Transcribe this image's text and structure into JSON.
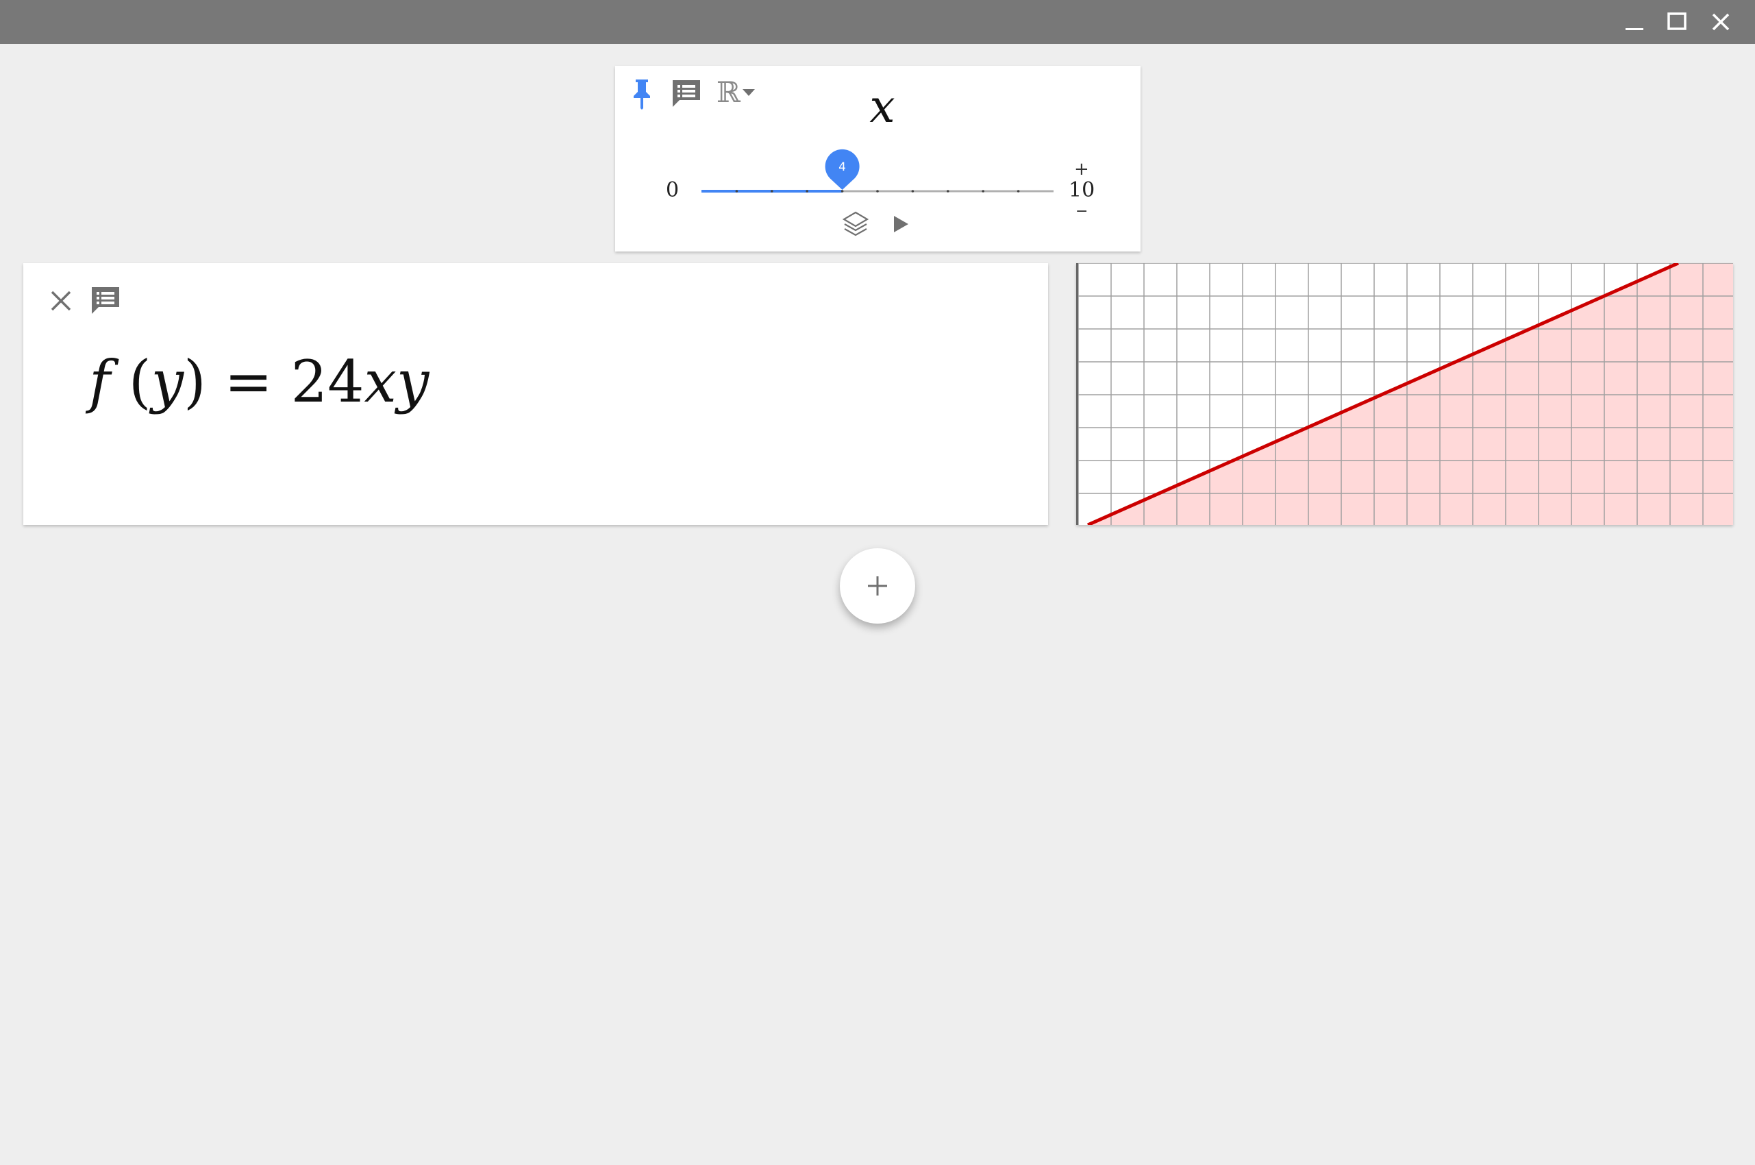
{
  "window": {
    "controls": {
      "minimize_icon": "minimize-icon",
      "maximize_icon": "maximize-icon",
      "close_icon": "close-icon"
    }
  },
  "slider_card": {
    "domain_symbol": "ℝ",
    "variable_name": "x",
    "min": "0",
    "max": "10",
    "value": "4",
    "value_fraction": 0.4,
    "plus_label": "+",
    "minus_label": "−",
    "accent_color": "#4285f4"
  },
  "function_card": {
    "lhs_name": "f",
    "lhs_arg": "y",
    "equals": "=",
    "rhs_coeff": "24",
    "rhs_vars": "xy"
  },
  "graph": {
    "line_color": "#cc0000",
    "fill_color": "#ffd9d9",
    "grid_color": "#a0a0a0"
  },
  "fab": {
    "label": "+"
  }
}
